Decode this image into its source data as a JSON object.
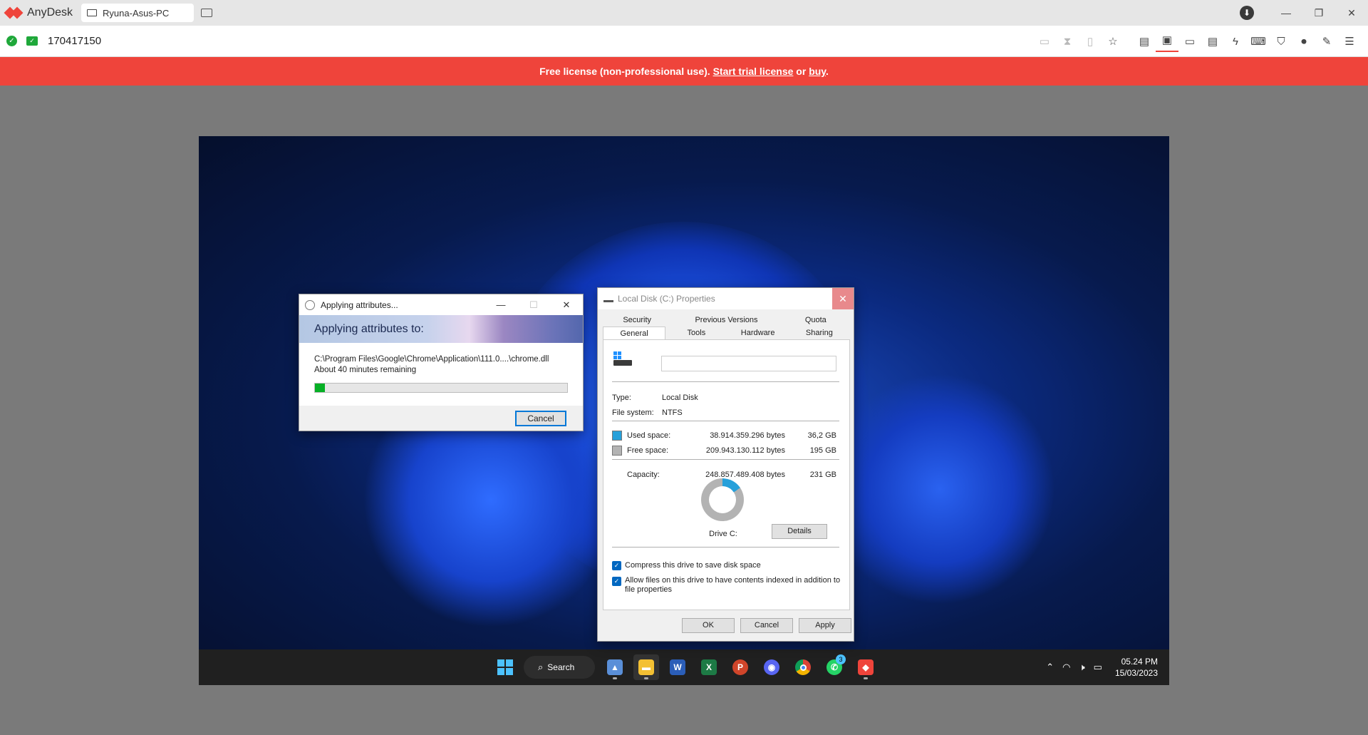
{
  "anydesk": {
    "app_name": "AnyDesk",
    "tab_title": "Ryuna-Asus-PC",
    "connection_id": "170417150",
    "window_controls": {
      "minimize": "—",
      "restore": "❐",
      "close": "✕"
    },
    "toolbar_icons": [
      "whiteboard-icon",
      "hourglass-icon",
      "record-icon",
      "favorite-icon",
      "file-transfer-icon",
      "monitor-switch-icon",
      "display-icon",
      "chat-icon",
      "actions-icon",
      "keyboard-icon",
      "permissions-icon",
      "recording-icon",
      "draw-icon",
      "menu-icon"
    ]
  },
  "banner": {
    "prefix": "Free license (non-professional use). ",
    "trial_link": "Start trial license",
    "middle": " or ",
    "buy_link": "buy",
    "suffix": "."
  },
  "apply_dialog": {
    "title": "Applying attributes...",
    "header": "Applying attributes to:",
    "path": "C:\\Program Files\\Google\\Chrome\\Application\\111.0....\\chrome.dll",
    "remaining": "About 40 minutes remaining",
    "progress": 0.04,
    "cancel": "Cancel",
    "controls": {
      "minimize": "—",
      "maximize": "☐",
      "close": "✕"
    }
  },
  "properties_dialog": {
    "title": "Local Disk (C:) Properties",
    "close": "✕",
    "tabs_row1": [
      "Security",
      "Previous Versions",
      "Quota"
    ],
    "tabs_row2": [
      "General",
      "Tools",
      "Hardware",
      "Sharing"
    ],
    "selected_tab": "General",
    "label_value": "",
    "type_label": "Type:",
    "type_value": "Local Disk",
    "fs_label": "File system:",
    "fs_value": "NTFS",
    "used_label": "Used space:",
    "used_bytes": "38.914.359.296 bytes",
    "used_gb": "36,2 GB",
    "free_label": "Free space:",
    "free_bytes": "209.943.130.112 bytes",
    "free_gb": "195 GB",
    "capacity_label": "Capacity:",
    "capacity_bytes": "248.857.489.408 bytes",
    "capacity_gb": "231 GB",
    "drive_label": "Drive C:",
    "details": "Details",
    "compress": "Compress this drive to save disk space",
    "index_line1": "Allow files on this drive to have contents indexed in addition to",
    "index_line2": "file properties",
    "ok": "OK",
    "cancel": "Cancel",
    "apply": "Apply",
    "colors": {
      "used": "#26a0da",
      "free": "#b3b3b3"
    }
  },
  "taskbar": {
    "search": "Search",
    "whatsapp_badge": "3",
    "time": "05.24 PM",
    "date": "15/03/2023"
  }
}
